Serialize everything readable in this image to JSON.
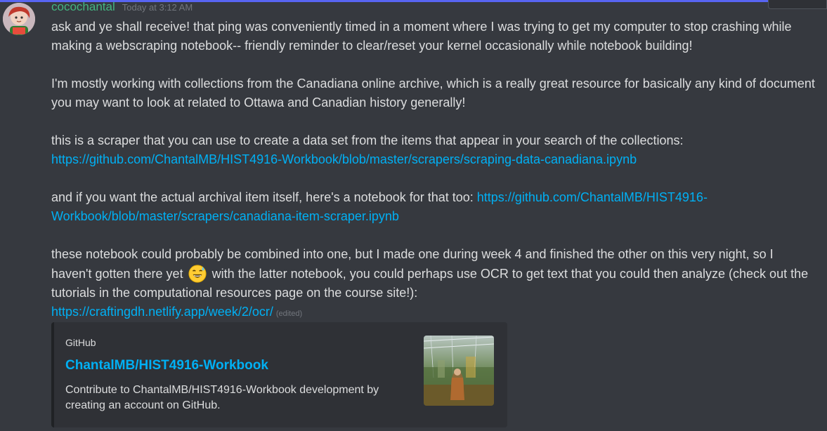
{
  "message": {
    "username": "cocochantal",
    "timestamp": "Today at 3:12 AM",
    "p1": "ask and ye shall receive! that ping was conveniently timed in a moment where I was trying to get my computer to stop crashing while making a webscraping notebook-- friendly reminder to clear/reset your kernel occasionally while notebook building!",
    "p2": "I'm mostly working with collections from the Canadiana online archive, which is a really great resource for basically any kind of document you may want to look at related to Ottawa and Canadian history generally!",
    "p3_text": "this is a scraper that you can use to create a data set from the items that appear in your search of the collections:",
    "p3_link": "https://github.com/ChantalMB/HIST4916-Workbook/blob/master/scrapers/scraping-data-canadiana.ipynb",
    "p4_text": "and if you want the actual archival item itself, here's a notebook for that too: ",
    "p4_link": "https://github.com/ChantalMB/HIST4916-Workbook/blob/master/scrapers/canadiana-item-scraper.ipynb",
    "p5_text_a": "these notebook could probably be combined into one, but I made one during week 4 and finished the other on this very night, so I haven't gotten there yet",
    "p5_emoji": "sweat-smile-emoji",
    "p5_text_b": "with the latter notebook, you could perhaps use OCR to get text that you could then analyze (check out the tutorials in the computational resources page on the course site!):",
    "p5_link": "https://craftingdh.netlify.app/week/2/ocr/",
    "edited_label": "(edited)"
  },
  "embed": {
    "provider": "GitHub",
    "title": "ChantalMB/HIST4916-Workbook",
    "description": "Contribute to ChantalMB/HIST4916-Workbook development by creating an account on GitHub.",
    "thumbnail": "repository-preview-image"
  },
  "colors": {
    "background": "#36393f",
    "username": "#43b581",
    "link": "#00b0f4",
    "text": "#dcddde",
    "muted": "#72767d",
    "embed_bg": "#2f3136",
    "accent_bar": "#5865f2"
  }
}
